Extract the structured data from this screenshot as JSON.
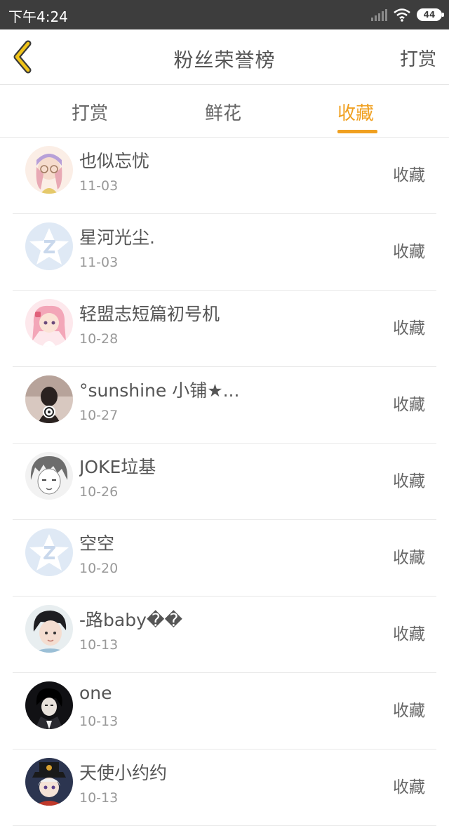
{
  "status_bar": {
    "time": "下午4:24",
    "battery": "44"
  },
  "header": {
    "title": "粉丝荣誉榜",
    "action_label": "打赏"
  },
  "tabs": [
    {
      "label": "打赏",
      "active": false
    },
    {
      "label": "鲜花",
      "active": false
    },
    {
      "label": "收藏",
      "active": true
    }
  ],
  "colors": {
    "accent": "#f0a020",
    "status_bar": "#3d3d3d",
    "text": "#555555",
    "muted": "#999999"
  },
  "list": [
    {
      "name": "也似忘忧",
      "date": "11-03",
      "tag": "收藏",
      "avatar": "anime-girl-glasses"
    },
    {
      "name": "星河光尘.",
      "date": "11-03",
      "tag": "收藏",
      "avatar": "default-star"
    },
    {
      "name": "轻盟志短篇初号机",
      "date": "10-28",
      "tag": "收藏",
      "avatar": "anime-girl-pink"
    },
    {
      "name": "°sunshine 小铺★...",
      "date": "10-27",
      "tag": "收藏",
      "avatar": "dark-photo"
    },
    {
      "name": "JOKE垃基",
      "date": "10-26",
      "tag": "收藏",
      "avatar": "sketch-face"
    },
    {
      "name": "空空",
      "date": "10-20",
      "tag": "收藏",
      "avatar": "default-star"
    },
    {
      "name": "-路baby��",
      "date": "10-13",
      "tag": "收藏",
      "avatar": "boy-photo"
    },
    {
      "name": "one",
      "date": "10-13",
      "tag": "收藏",
      "avatar": "dark-figure"
    },
    {
      "name": "天使小约约",
      "date": "10-13",
      "tag": "收藏",
      "avatar": "anime-hat"
    }
  ]
}
